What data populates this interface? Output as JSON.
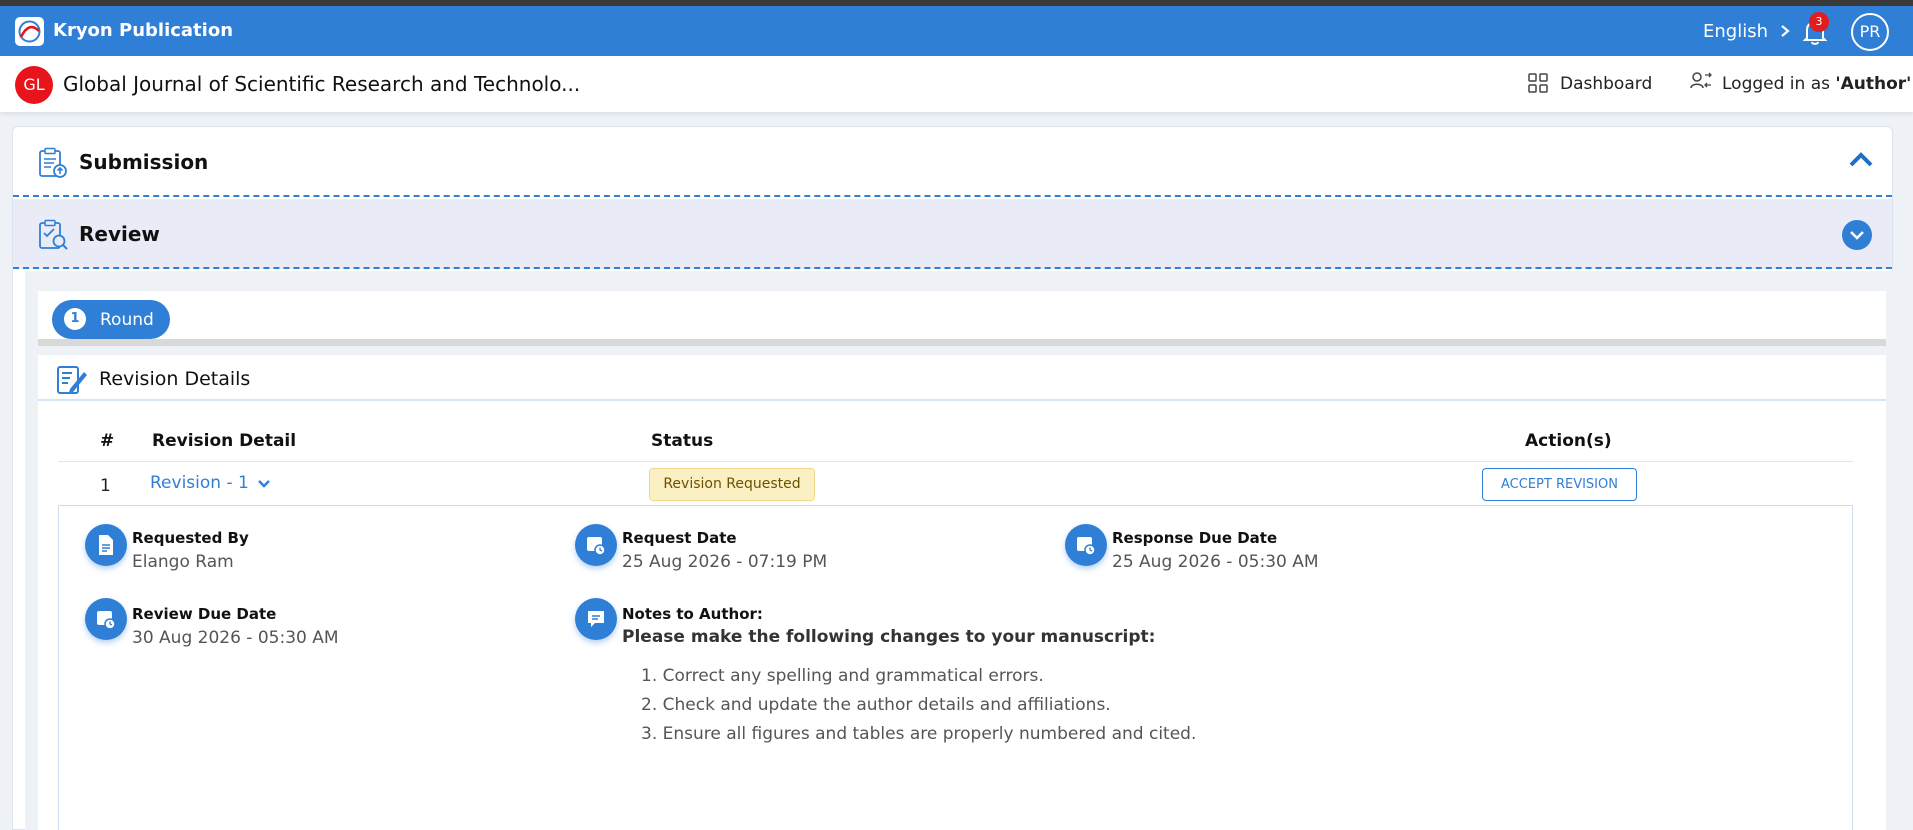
{
  "app": {
    "title": "Kryon Publication",
    "language": "English",
    "notification_count": "3",
    "user_initials": "PR"
  },
  "journal": {
    "badge": "GL",
    "title": "Global Journal of Scientific Research and Technolo...",
    "dashboard_label": "Dashboard",
    "logged_in_prefix": "Logged in as ",
    "role": "'Author'"
  },
  "sections": {
    "submission": "Submission",
    "review": "Review"
  },
  "round": {
    "number": "1",
    "label": "Round"
  },
  "revision_details": {
    "title": "Revision Details",
    "columns": [
      "#",
      "Revision Detail",
      "Status",
      "Action(s)"
    ],
    "row": {
      "index": "1",
      "revision": "Revision - 1",
      "status": "Revision Requested",
      "action": "ACCEPT REVISION"
    }
  },
  "details": {
    "requested_by_label": "Requested By",
    "requested_by": "Elango Ram",
    "request_date_label": "Request Date",
    "request_date": "25 Aug 2026 - 07:19 PM",
    "response_due_label": "Response Due Date",
    "response_due": "25 Aug 2026 - 05:30 AM",
    "review_due_label": "Review Due Date",
    "review_due": "30 Aug 2026 - 05:30 AM",
    "notes_label": "Notes to Author:",
    "notes_heading": "Please make the following changes to your manuscript:",
    "notes_items": [
      "1. Correct any spelling and grammatical errors.",
      "2. Check and update the author details and affiliations.",
      "3. Ensure all figures and tables are properly numbered and cited."
    ]
  },
  "colors": {
    "primary": "#2f7fd6",
    "badge_red": "#e8141b",
    "status_bg": "#fbefc4",
    "review_bg": "#e9ecf7"
  }
}
